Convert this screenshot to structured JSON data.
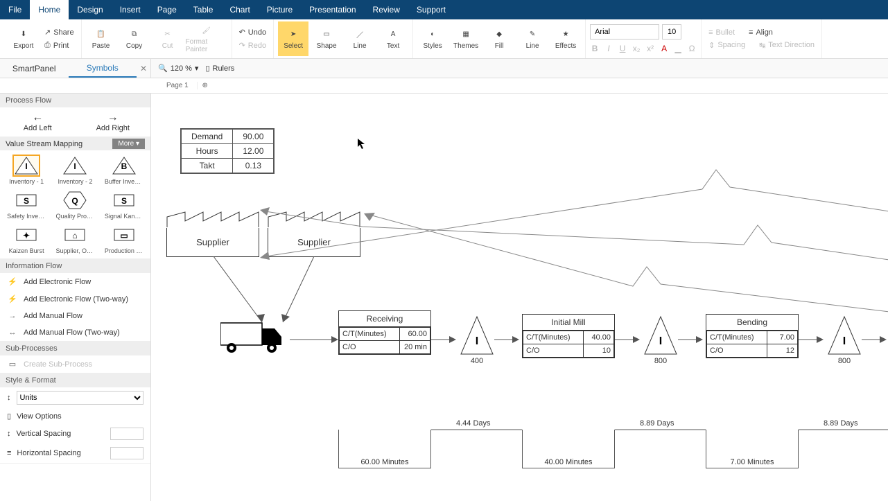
{
  "menu": [
    "File",
    "Home",
    "Design",
    "Insert",
    "Page",
    "Table",
    "Chart",
    "Picture",
    "Presentation",
    "Review",
    "Support"
  ],
  "menu_active": 1,
  "ribbon": {
    "export": "Export",
    "share": "Share",
    "print": "Print",
    "paste": "Paste",
    "copy": "Copy",
    "cut": "Cut",
    "format_painter": "Format Painter",
    "undo": "Undo",
    "redo": "Redo",
    "select": "Select",
    "shape": "Shape",
    "line": "Line",
    "text": "Text",
    "styles": "Styles",
    "themes": "Themes",
    "fill": "Fill",
    "line2": "Line",
    "effects": "Effects",
    "font_name": "Arial",
    "font_size": "10",
    "bullet": "Bullet",
    "align": "Align",
    "spacing": "Spacing",
    "text_direction": "Text Direction"
  },
  "secbar": {
    "smartpanel": "SmartPanel",
    "symbols": "Symbols",
    "zoom": "120 %",
    "rulers": "Rulers"
  },
  "pagetabs": {
    "page1": "Page 1"
  },
  "sidebar": {
    "process_flow": "Process Flow",
    "add_left": "Add Left",
    "add_right": "Add Right",
    "vsm": "Value Stream Mapping",
    "more": "More",
    "symbols": [
      {
        "label": "Inventory - 1",
        "glyph": "I",
        "selected": true
      },
      {
        "label": "Inventory - 2",
        "glyph": "I"
      },
      {
        "label": "Buffer Inventory",
        "glyph": "B"
      },
      {
        "label": "Safety Inventory",
        "glyph": "S"
      },
      {
        "label": "Quality Problem",
        "glyph": "Q"
      },
      {
        "label": "Signal Kanban",
        "glyph": "S"
      },
      {
        "label": "Kaizen Burst",
        "glyph": "✦"
      },
      {
        "label": "Supplier, Outs...",
        "glyph": "⌂"
      },
      {
        "label": "Production Co...",
        "glyph": "▭"
      }
    ],
    "info_flow": "Information Flow",
    "info_items": [
      "Add Electronic Flow",
      "Add Electronic Flow (Two-way)",
      "Add Manual Flow",
      "Add Manual Flow (Two-way)"
    ],
    "sub_processes": "Sub-Processes",
    "create_sub": "Create Sub-Process",
    "style_format": "Style & Format",
    "units": "Units",
    "view_options": "View Options",
    "vspacing": "Vertical Spacing",
    "hspacing": "Horizontal Spacing"
  },
  "canvas": {
    "databox": {
      "demand_l": "Demand",
      "demand_v": "90.00",
      "hours_l": "Hours",
      "hours_v": "12.00",
      "takt_l": "Takt",
      "takt_v": "0.13"
    },
    "supplier1": "Supplier",
    "supplier2": "Supplier",
    "receiving": {
      "title": "Receiving",
      "ct_l": "C/T(Minutes)",
      "ct_v": "60.00",
      "co_l": "C/O",
      "co_v": "20 min"
    },
    "initial_mill": {
      "title": "Initial Mill",
      "ct_l": "C/T(Minutes)",
      "ct_v": "40.00",
      "co_l": "C/O",
      "co_v": "10"
    },
    "bending": {
      "title": "Bending",
      "ct_l": "C/T(Minutes)",
      "ct_v": "7.00",
      "co_l": "C/O",
      "co_v": "12"
    },
    "inv1": {
      "glyph": "I",
      "val": "400"
    },
    "inv2": {
      "glyph": "I",
      "val": "800"
    },
    "inv3": {
      "glyph": "I",
      "val": "800"
    },
    "days1": "4.44 Days",
    "days2": "8.89 Days",
    "days3": "8.89 Days",
    "mins1": "60.00 Minutes",
    "mins2": "40.00 Minutes",
    "mins3": "7.00 Minutes"
  }
}
